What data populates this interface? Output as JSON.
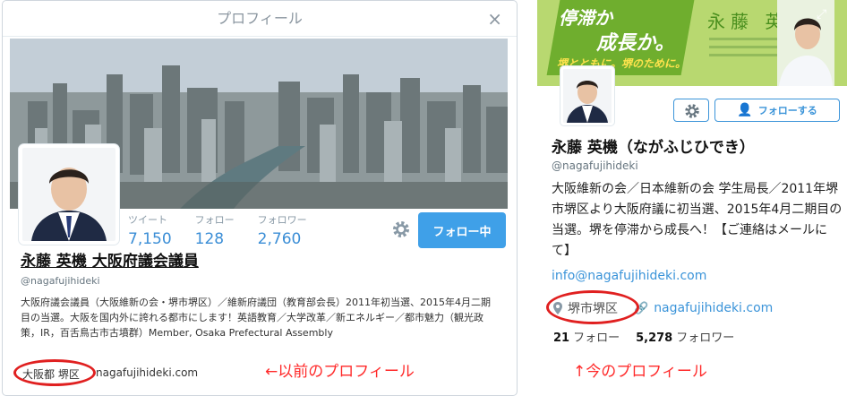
{
  "old_profile": {
    "modal_title": "プロフィール",
    "close_glyph": "×",
    "stats": [
      {
        "label": "ツイート",
        "value": "7,150"
      },
      {
        "label": "フォロー",
        "value": "128"
      },
      {
        "label": "フォロワー",
        "value": "2,760"
      }
    ],
    "follow_button": "フォロー中",
    "name": "永藤 英機 大阪府議会議員",
    "handle": "@nagafujihideki",
    "bio": "大阪府議会議員（大阪維新の会・堺市堺区）／維新府議団（教育部会長）2011年初当選、2015年4月二期目の当選。大阪を国内外に誇れる都市にします！英語教育／大学改革／新エネルギー／都市魅力（観光政策，IR，百舌鳥古市古墳群）Member, Osaka Prefectural Assembly",
    "location": "大阪都 堺区",
    "url": "nagafujihideki.com",
    "caption": "←以前のプロフィール"
  },
  "new_profile": {
    "banner": {
      "slogan1": "停滞か",
      "slogan2": "成長か。",
      "tagline": "堺とともに。堺のために。",
      "name": "永藤 英機"
    },
    "follow_button": "フォローする",
    "name": "永藤 英機（ながふじひでき）",
    "handle": "@nagafujihideki",
    "bio": "大阪維新の会／日本維新の会 学生局長／2011年堺市堺区より大阪府議に初当選、2015年4月二期目の当選。堺を停滞から成長へ！【ご連絡はメールにて】",
    "email": "info@nagafujihideki.com",
    "location": "堺市堺区",
    "url": "nagafujihideki.com",
    "following_count": "21",
    "following_label": "フォロー",
    "followers_count": "5,278",
    "followers_label": "フォロワー",
    "caption": "↑今のプロフィール"
  },
  "colors": {
    "accent_blue": "#3b94d9",
    "annotation_red": "#e02020",
    "banner_green": "#6fae2e"
  }
}
